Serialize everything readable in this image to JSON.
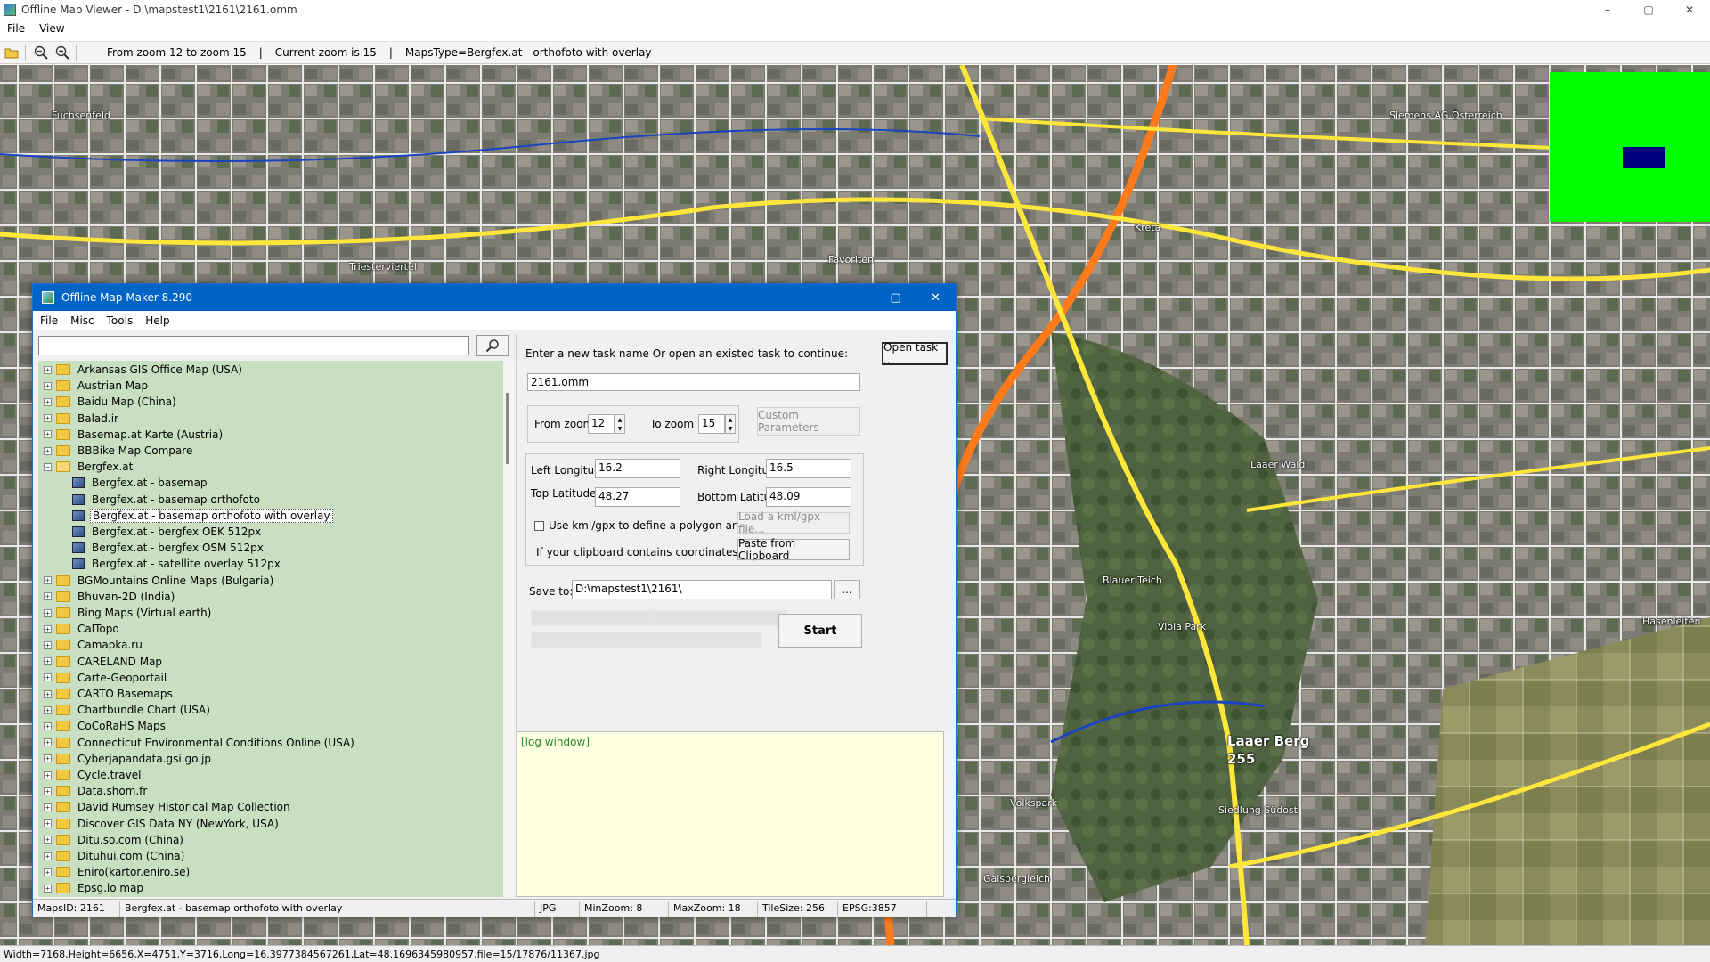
{
  "window": {
    "title": "Offline Map Viewer - D:\\mapstest1\\2161\\2161.omm",
    "menu": [
      "File",
      "View"
    ],
    "controls": {
      "minimize": "–",
      "maximize": "▢",
      "close": "✕"
    }
  },
  "toolbar": {
    "icons": [
      "folder-open-icon",
      "zoom-out-icon",
      "zoom-in-icon"
    ],
    "zoom_range": "From zoom 12 to zoom 15",
    "sep1": "|",
    "current_zoom": "Current zoom is 15",
    "sep2": "|",
    "maps_type": "MapsType=Bergfex.at - orthofoto with overlay"
  },
  "map_labels": [
    {
      "text": "Fuchsenfeld",
      "big": false
    },
    {
      "text": "Triesterviertel",
      "big": false
    },
    {
      "text": "Favoriten",
      "big": false
    },
    {
      "text": "Kreta",
      "big": false
    },
    {
      "text": "Laaer Berg",
      "big": true
    },
    {
      "text": "255",
      "big": true
    },
    {
      "text": "Siedlung Südost",
      "big": false
    },
    {
      "text": "Hasenleiten",
      "big": false
    },
    {
      "text": "Volkspark",
      "big": false
    },
    {
      "text": "Blauer Teich",
      "big": false
    },
    {
      "text": "Viola Park",
      "big": false
    },
    {
      "text": "Gaisbergleich",
      "big": false
    },
    {
      "text": "Siemens AG Österreich",
      "big": false
    },
    {
      "text": "Laaer Wald",
      "big": false
    }
  ],
  "statusbar": "Width=7168,Height=6656,X=4751,Y=3716,Long=16.3977384567261,Lat=48.1696345980957,file=15/17876/11367.jpg",
  "dialog": {
    "title": "Offline Map Maker 8.290",
    "menu": [
      "File",
      "Misc",
      "Tools",
      "Help"
    ],
    "controls": {
      "minimize": "–",
      "maximize": "▢",
      "close": "✕"
    },
    "search": {
      "value": "",
      "icon": "search-icon"
    },
    "tree": [
      {
        "label": "Arkansas GIS Office Map (USA)",
        "level": 0,
        "type": "folder",
        "expanded": false
      },
      {
        "label": "Austrian Map",
        "level": 0,
        "type": "folder",
        "expanded": false
      },
      {
        "label": "Baidu Map (China)",
        "level": 0,
        "type": "folder",
        "expanded": false
      },
      {
        "label": "Balad.ir",
        "level": 0,
        "type": "folder",
        "expanded": false
      },
      {
        "label": "Basemap.at Karte (Austria)",
        "level": 0,
        "type": "folder",
        "expanded": false
      },
      {
        "label": "BBBike Map Compare",
        "level": 0,
        "type": "folder",
        "expanded": false
      },
      {
        "label": "Bergfex.at",
        "level": 0,
        "type": "folder",
        "expanded": true
      },
      {
        "label": "Bergfex.at - basemap",
        "level": 1,
        "type": "map"
      },
      {
        "label": "Bergfex.at - basemap orthofoto",
        "level": 1,
        "type": "map"
      },
      {
        "label": "Bergfex.at - basemap orthofoto with overlay",
        "level": 1,
        "type": "map",
        "selected": true
      },
      {
        "label": "Bergfex.at - bergfex OEK 512px",
        "level": 1,
        "type": "map"
      },
      {
        "label": "Bergfex.at - bergfex OSM 512px",
        "level": 1,
        "type": "map"
      },
      {
        "label": "Bergfex.at - satellite overlay 512px",
        "level": 1,
        "type": "map"
      },
      {
        "label": "BGMountains Online Maps (Bulgaria)",
        "level": 0,
        "type": "folder",
        "expanded": false
      },
      {
        "label": "Bhuvan-2D (India)",
        "level": 0,
        "type": "folder",
        "expanded": false
      },
      {
        "label": "Bing Maps (Virtual earth)",
        "level": 0,
        "type": "folder",
        "expanded": false
      },
      {
        "label": "CalTopo",
        "level": 0,
        "type": "folder",
        "expanded": false
      },
      {
        "label": "Camapka.ru",
        "level": 0,
        "type": "folder",
        "expanded": false
      },
      {
        "label": "CARELAND Map",
        "level": 0,
        "type": "folder",
        "expanded": false
      },
      {
        "label": "Carte-Geoportail",
        "level": 0,
        "type": "folder",
        "expanded": false
      },
      {
        "label": "CARTO Basemaps",
        "level": 0,
        "type": "folder",
        "expanded": false
      },
      {
        "label": "Chartbundle Chart (USA)",
        "level": 0,
        "type": "folder",
        "expanded": false
      },
      {
        "label": "CoCoRaHS Maps",
        "level": 0,
        "type": "folder",
        "expanded": false
      },
      {
        "label": "Connecticut Environmental Conditions Online (USA)",
        "level": 0,
        "type": "folder",
        "expanded": false
      },
      {
        "label": "Cyberjapandata.gsi.go.jp",
        "level": 0,
        "type": "folder",
        "expanded": false
      },
      {
        "label": "Cycle.travel",
        "level": 0,
        "type": "folder",
        "expanded": false
      },
      {
        "label": "Data.shom.fr",
        "level": 0,
        "type": "folder",
        "expanded": false
      },
      {
        "label": "David Rumsey Historical Map Collection",
        "level": 0,
        "type": "folder",
        "expanded": false
      },
      {
        "label": "Discover GIS Data NY (NewYork, USA)",
        "level": 0,
        "type": "folder",
        "expanded": false
      },
      {
        "label": "Ditu.so.com (China)",
        "level": 0,
        "type": "folder",
        "expanded": false
      },
      {
        "label": "Dituhui.com (China)",
        "level": 0,
        "type": "folder",
        "expanded": false
      },
      {
        "label": "Eniro(kartor.eniro.se)",
        "level": 0,
        "type": "folder",
        "expanded": false
      },
      {
        "label": "Epsg.io map",
        "level": 0,
        "type": "folder",
        "expanded": false
      }
    ],
    "task": {
      "prompt": "Enter a new task name Or open an existed task to continue:",
      "open_button": "Open task ...",
      "name_value": "2161.omm"
    },
    "zoom": {
      "from_label": "From zoom",
      "from_value": "12",
      "to_label": "To zoom",
      "to_value": "15",
      "custom_button": "Custom Parameters"
    },
    "coords": {
      "left_label": "Left Longitude",
      "left_value": "16.2",
      "right_label": "Right Longitude",
      "right_value": "16.5",
      "top_label": "Top Latitude",
      "top_value": "48.27",
      "bottom_label": "Bottom Latitude",
      "bottom_value": "48.09",
      "kml_label": "Use kml/gpx to define a polygon area",
      "kml_checked": false,
      "load_button": "Load a kml/gpx file...",
      "clipboard_label": "If your clipboard contains coordinates values:",
      "paste_button": "Paste from Clipboard"
    },
    "save": {
      "label": "Save to:",
      "value": "D:\\mapstest1\\2161\\",
      "browse_button": "..."
    },
    "start_button": "Start",
    "log_text": "[log window]",
    "status": {
      "maps_id": "MapsID: 2161",
      "map_name": "Bergfex.at - basemap orthofoto with overlay",
      "format": "JPG",
      "min_zoom": "MinZoom: 8",
      "max_zoom": "MaxZoom: 18",
      "tile_size": "TileSize: 256",
      "epsg": "EPSG:3857"
    }
  }
}
